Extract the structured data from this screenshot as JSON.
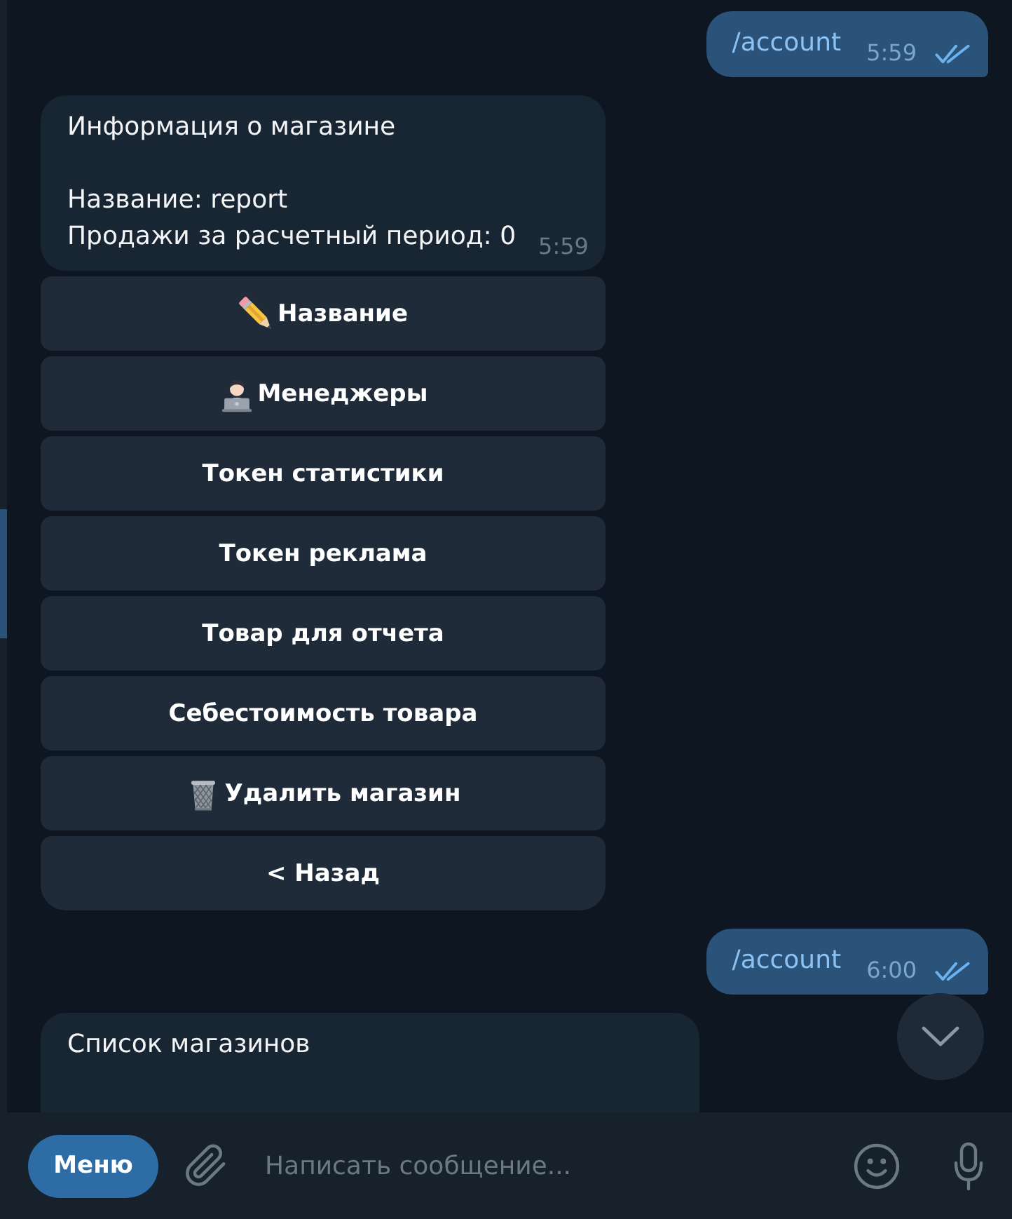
{
  "chat": {
    "messages": [
      {
        "kind": "outgoing",
        "text": "/account",
        "time": "5:59",
        "read": true
      },
      {
        "kind": "incoming",
        "title": "Информация о магазине",
        "lines": [
          "Название: report",
          "Продажи за расчетный период: 0"
        ],
        "time": "5:59",
        "buttons": [
          {
            "label": "Название",
            "kind": "edit"
          },
          {
            "label": "Менеджеры",
            "kind": "managers"
          },
          {
            "label": "Токен статистики",
            "kind": "plain"
          },
          {
            "label": "Токен реклама",
            "kind": "plain"
          },
          {
            "label": "Товар для отчета",
            "kind": "plain"
          },
          {
            "label": "Себестоимость товара",
            "kind": "plain"
          },
          {
            "label": "Удалить магазин",
            "kind": "delete"
          },
          {
            "label": "< Назад",
            "kind": "plain"
          }
        ]
      },
      {
        "kind": "outgoing",
        "text": "/account",
        "time": "6:00",
        "read": true
      },
      {
        "kind": "incoming",
        "title": "Список магазинов"
      }
    ]
  },
  "composer": {
    "menu_button": "Меню",
    "placeholder": "Написать сообщение..."
  }
}
